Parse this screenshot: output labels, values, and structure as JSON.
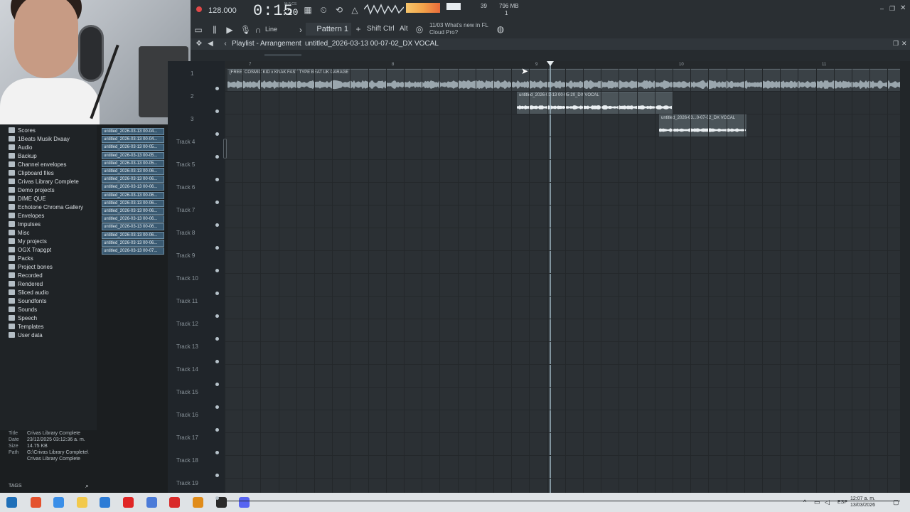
{
  "transport": {
    "tempo": "128.000",
    "time_main": "0:15",
    "time_frac": ":20",
    "time_unit": "M:S:CS",
    "cpu": "39",
    "ram": "796 MB",
    "poly": "1"
  },
  "toolbar": {
    "snap": "Line",
    "pattern": "Pattern 1",
    "shift": "Shift",
    "ctrl": "Ctrl",
    "alt": "Alt",
    "news_date": "11/03",
    "news": "What's new in FL Cloud Pro?"
  },
  "playlist": {
    "title": "Playlist - Arrangement",
    "separator": "›",
    "file": "untitled_2026-03-13 00-07-02_DX VOCAL"
  },
  "ruler": [
    "7",
    "8",
    "9",
    "10",
    "11"
  ],
  "clips": [
    {
      "label": "[FREE] COSMIC KID x KNAK FAST TYPE BEAT  UK GARAGE"
    },
    {
      "label": "untitled_2026-03-13 00-05-20_DX VOCAL"
    },
    {
      "label": "untitled_2026-03...0-07-02_DX VOCAL"
    }
  ],
  "tracks": [
    "1",
    "2",
    "3",
    "Track 4",
    "Track 5",
    "Track 6",
    "Track 7",
    "Track 8",
    "Track 9",
    "Track 10",
    "Track 11",
    "Track 12",
    "Track 13",
    "Track 14",
    "Track 15",
    "Track 16",
    "Track 17",
    "Track 18",
    "Track 19"
  ],
  "browser": {
    "items": [
      "Scores",
      "1Beats Musik Dxaay",
      "Audio",
      "Backup",
      "Channel envelopes",
      "Clipboard files",
      "Crivas Library Complete",
      "Demo projects",
      "DIME QUE",
      "Echotone Chroma Gallery",
      "Envelopes",
      "Impulses",
      "Misc",
      "My projects",
      "OGX Trapgpt",
      "Packs",
      "Project bones",
      "Recorded",
      "Rendered",
      "Sliced audio",
      "Soundfonts",
      "Sounds",
      "Speech",
      "Templates",
      "User data"
    ],
    "files": [
      "untitled_2026-03-13 00-04...",
      "untitled_2026-03-13 00-04...",
      "untitled_2026-03-13 00-05...",
      "untitled_2026-03-13 00-05...",
      "untitled_2026-03-13 00-05...",
      "untitled_2026-03-13 00-06...",
      "untitled_2026-03-13 00-06...",
      "untitled_2026-03-13 00-06...",
      "untitled_2026-03-13 00-06...",
      "untitled_2026-03-13 00-06...",
      "untitled_2026-03-13 00-06...",
      "untitled_2026-03-13 00-06...",
      "untitled_2026-03-13 00-06...",
      "untitled_2026-03-13 00-06...",
      "untitled_2026-03-13 00-06...",
      "untitled_2026-03-13 00-07..."
    ],
    "info": {
      "title_label": "Title",
      "title": "Crivas Library Complete",
      "date_label": "Date",
      "date": "23/12/2025 03:12:36 a. m.",
      "size_label": "Size",
      "size": "14.75 KB",
      "path_label": "Path",
      "path": "G:\\Crivas Library Complete\\",
      "path2": "Crivas Library Complete"
    },
    "tags": "TAGS"
  },
  "taskbar": {
    "lang": "ESP",
    "time": "12:07 a. m.",
    "date": "13/03/2026"
  }
}
